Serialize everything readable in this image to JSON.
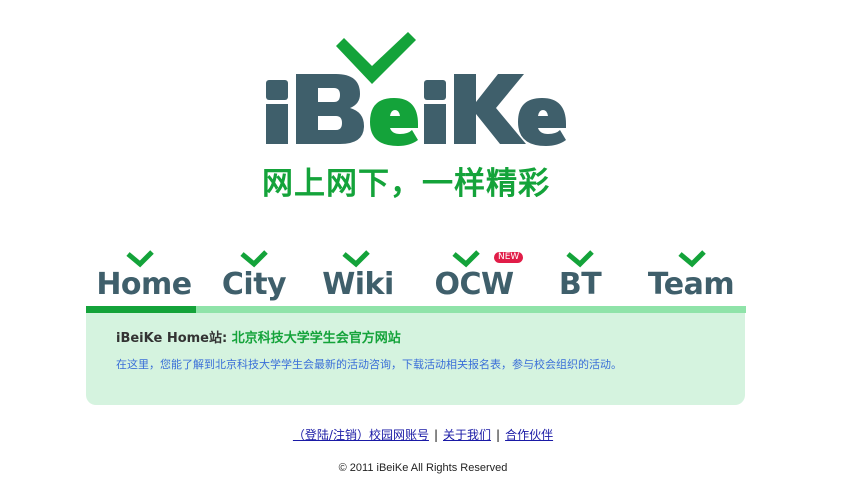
{
  "logo": {
    "text": "iBeiKe",
    "slogan": "网上网下，一样精彩",
    "colors": {
      "primary": "#3f5f6b",
      "accent": "#14a33a"
    }
  },
  "tabs": [
    {
      "label": "Home",
      "icon": "check-icon",
      "active": true
    },
    {
      "label": "City",
      "icon": "check-icon",
      "active": false
    },
    {
      "label": "Wiki",
      "icon": "check-icon",
      "active": false
    },
    {
      "label": "OCW",
      "icon": "check-icon",
      "active": false,
      "badge": "NEW"
    },
    {
      "label": "BT",
      "icon": "check-icon",
      "active": false
    },
    {
      "label": "Team",
      "icon": "check-icon",
      "active": false
    }
  ],
  "panel": {
    "title_prefix": "iBeiKe Home站:",
    "site_name": "北京科技大学学生会官方网站",
    "description": "在这里，您能了解到北京科技大学学生会最新的活动咨询，下载活动相关报名表，参与校会组织的活动。"
  },
  "footer": {
    "login_link": "（登陆/注销）校园网账号",
    "about_link": "关于我们",
    "partners_link": "合作伙伴",
    "separator": "|",
    "copyright": "© 2011 iBeiKe All Rights Reserved"
  }
}
